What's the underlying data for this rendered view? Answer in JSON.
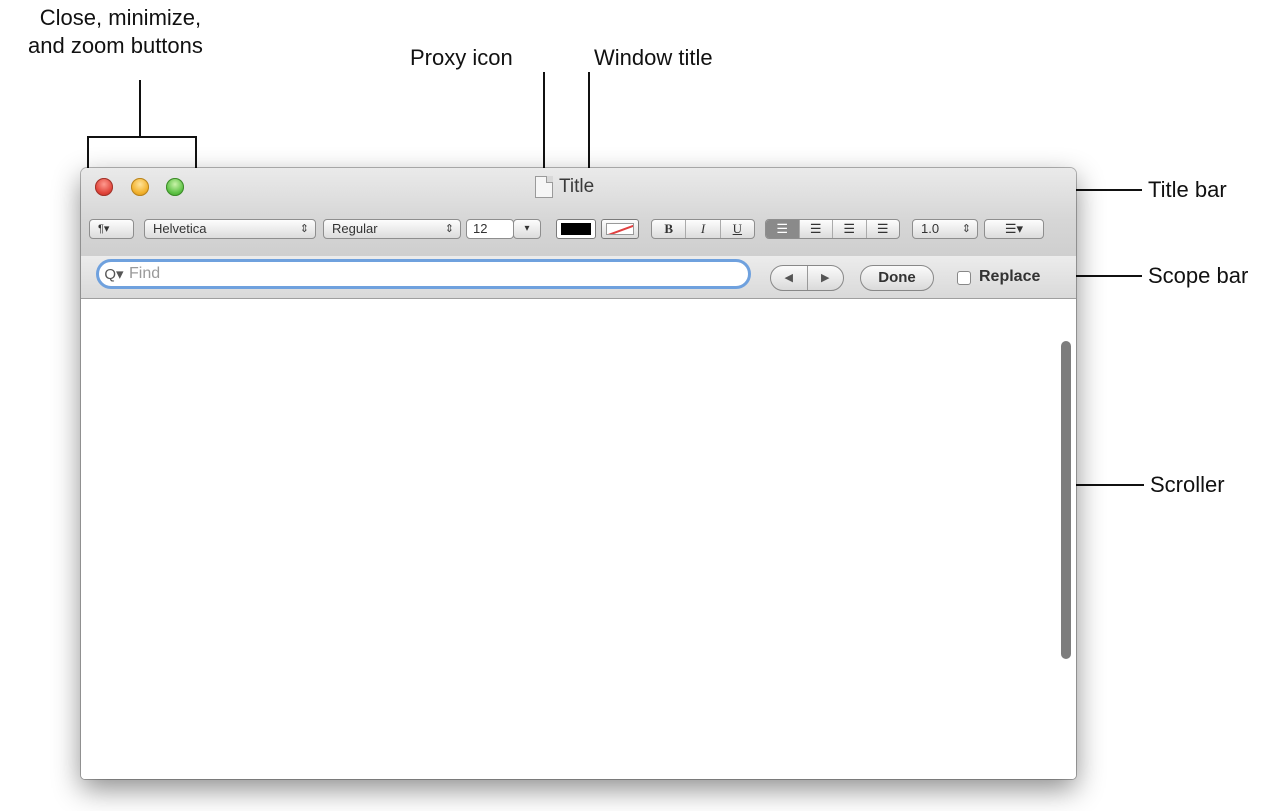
{
  "callouts": {
    "close_buttons_line1": "Close, minimize,",
    "close_buttons_line2": "and zoom buttons",
    "proxy_icon": "Proxy icon",
    "window_title": "Window title",
    "title_bar": "Title bar",
    "scope_bar": "Scope bar",
    "scroller": "Scroller"
  },
  "window": {
    "title": "Title"
  },
  "format_bar": {
    "paragraph_menu": "¶▾",
    "font_family": "Helvetica",
    "font_style": "Regular",
    "font_size": "12",
    "dropdown_arrow": "▾",
    "bold": "B",
    "italic": "I",
    "underline": "U",
    "line_spacing": "1.0",
    "list_menu": "☰▾",
    "stepper_symbol": "⇕",
    "text_color": "#000000",
    "highlight_color": "#ffffff"
  },
  "scope_bar": {
    "search_icon": "Q▾",
    "search_placeholder": "Find",
    "prev": "◀",
    "next": "▶",
    "done_label": "Done",
    "replace_label": "Replace",
    "replace_checked": false
  },
  "icons": {
    "close": "close-button",
    "minimize": "minimize-button",
    "zoom": "zoom-button",
    "proxy": "document-icon"
  }
}
